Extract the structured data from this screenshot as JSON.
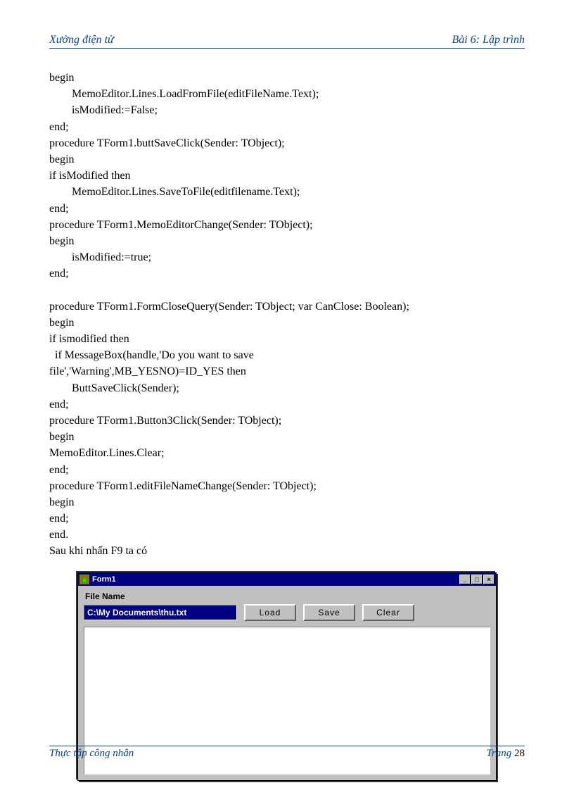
{
  "header": {
    "left": "Xưởng điện tử",
    "right": "Bài 6: Lập trình"
  },
  "code": "begin\n        MemoEditor.Lines.LoadFromFile(editFileName.Text);\n        isModified:=False;\nend;\nprocedure TForm1.buttSaveClick(Sender: TObject);\nbegin\nif isModified then\n        MemoEditor.Lines.SaveToFile(editfilename.Text);\nend;\nprocedure TForm1.MemoEditorChange(Sender: TObject);\nbegin\n        isModified:=true;\nend;\n\nprocedure TForm1.FormCloseQuery(Sender: TObject; var CanClose: Boolean);\nbegin\nif ismodified then\n  if MessageBox(handle,'Do you want to save\nfile','Warning',MB_YESNO)=ID_YES then\n        ButtSaveClick(Sender);\nend;\nprocedure TForm1.Button3Click(Sender: TObject);\nbegin\nMemoEditor.Lines.Clear;\nend;\nprocedure TForm1.editFileNameChange(Sender: TObject);\nbegin\nend;\nend.\nSau khi nhấn F9 ta có",
  "window": {
    "title": "Form1",
    "filename_label": "File Name",
    "path_value": "C:\\My Documents\\thu.txt",
    "buttons": {
      "load": "Load",
      "save": "Save",
      "clear": "Clear"
    }
  },
  "footer": {
    "left": "Thực tập công nhân",
    "right_label": "Trang",
    "page_num": "28"
  }
}
